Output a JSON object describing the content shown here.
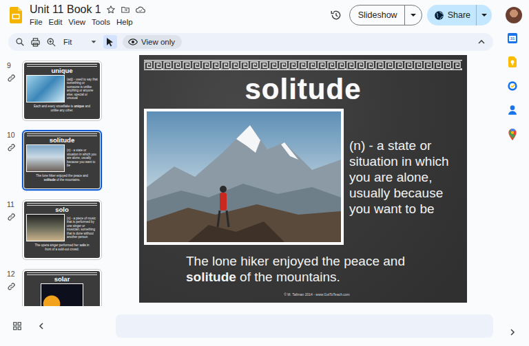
{
  "window": {
    "title": "Unit 11 Book 1"
  },
  "menu": [
    "File",
    "Edit",
    "View",
    "Tools",
    "Help"
  ],
  "header": {
    "slideshow": "Slideshow",
    "share": "Share"
  },
  "toolbar": {
    "zoom": "Fit",
    "pointer_selected": true,
    "mode": "View only"
  },
  "slides": [
    {
      "number": "9",
      "title": "unique",
      "definition": "(adj) - used to say that something or someone is unlike anything or anyone else; special or unusual",
      "example": [
        {
          "text": "Each and every snowflake is ",
          "bold": false
        },
        {
          "text": "unique",
          "bold": true
        },
        {
          "text": " and unlike any other.",
          "bold": false
        }
      ],
      "selected": false,
      "linked": true
    },
    {
      "number": "10",
      "title": "solitude",
      "definition": "(n) - a state or situation in which you are alone, usually because you want to be",
      "example": [
        {
          "text": "The lone hiker enjoyed the peace and ",
          "bold": false
        },
        {
          "text": "solitude",
          "bold": true
        },
        {
          "text": " of the mountains.",
          "bold": false
        }
      ],
      "selected": true,
      "linked": true
    },
    {
      "number": "11",
      "title": "solo",
      "definition": "(n) - a piece of music that is performed by one singer or musician; something that is done without another person",
      "example": [
        {
          "text": "The opera singer performed her ",
          "bold": false
        },
        {
          "text": "solo",
          "bold": true
        },
        {
          "text": " in front of a sold-out crowd.",
          "bold": false
        }
      ],
      "selected": false,
      "linked": true
    },
    {
      "number": "12",
      "title": "solar",
      "definition": "",
      "example": [],
      "selected": false,
      "linked": true
    }
  ],
  "current_slide": {
    "title": "solitude",
    "definition": "(n) - a state or situation in which you are alone, usually because you want to be",
    "example": [
      {
        "text": "The lone hiker enjoyed the peace and ",
        "bold": false
      },
      {
        "text": "solitude",
        "bold": true
      },
      {
        "text": " of the mountains.",
        "bold": false
      }
    ],
    "credit": "© M. Tallman 2014 - www.GotToTeach.com"
  },
  "side_panel": {
    "calendar_day": "31"
  }
}
